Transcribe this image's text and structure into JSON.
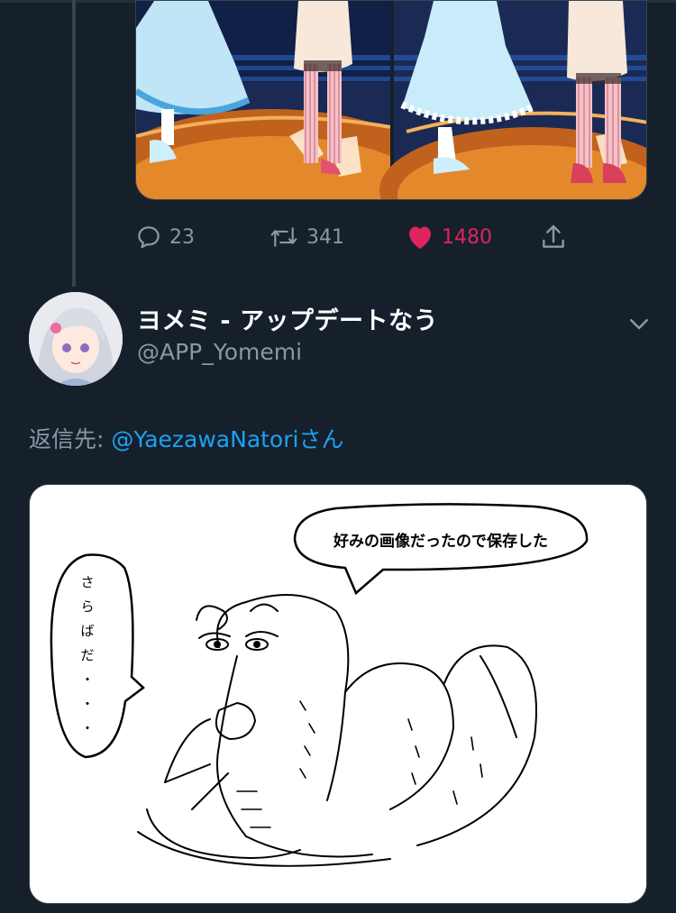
{
  "tweet_actions": {
    "replies": "23",
    "retweets": "341",
    "likes": "1480",
    "colors": {
      "muted": "#8899a6",
      "like": "#e0245e",
      "link": "#1da1f2"
    }
  },
  "reply_tweet": {
    "display_name": "ヨメミ - アップデートなう",
    "handle": "@APP_Yomemi",
    "replying_to_prefix": "返信先: ",
    "replying_to_mention": "@YaezawaNatori",
    "replying_to_suffix": "さん",
    "image": {
      "speech_bubble_right": "好みの画像だったので保存した",
      "speech_bubble_left": [
        "さ",
        "ら",
        "ば",
        "だ",
        "・",
        "・",
        "・"
      ]
    }
  },
  "icons": [
    "reply-icon",
    "retweet-icon",
    "heart-icon",
    "share-icon",
    "chevron-down-icon"
  ]
}
